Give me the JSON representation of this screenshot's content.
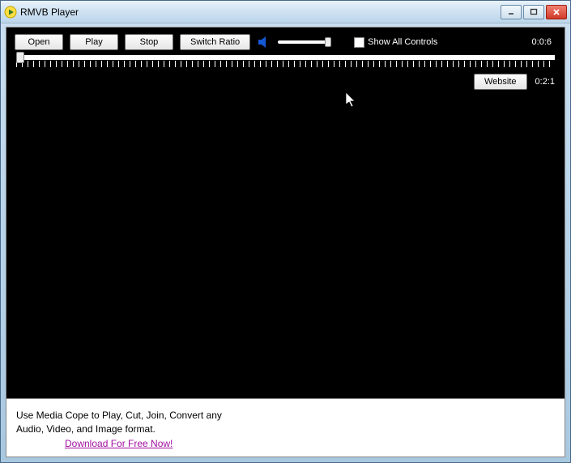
{
  "window": {
    "title": "RMVB Player"
  },
  "toolbar": {
    "open": "Open",
    "play": "Play",
    "stop": "Stop",
    "switch_ratio": "Switch Ratio",
    "show_all_controls": "Show All Controls",
    "time_total": "0:0:6"
  },
  "row2": {
    "website": "Website",
    "ratio": "0:2:1"
  },
  "footer": {
    "line1": "Use Media Cope to Play, Cut, Join, Convert any",
    "line2": "Audio, Video, and Image format.",
    "link": "Download For Free Now!"
  }
}
